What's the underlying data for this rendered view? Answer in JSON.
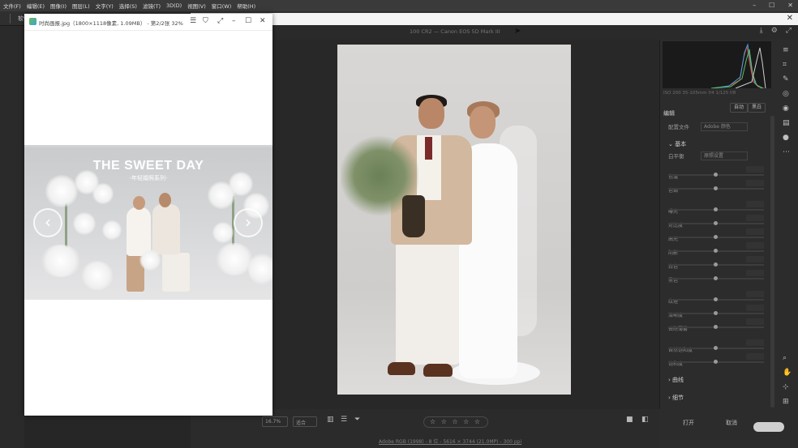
{
  "photoshop": {
    "menu": [
      "文件(F)",
      "编辑(E)",
      "图像(I)",
      "图层(L)",
      "文字(Y)",
      "选择(S)",
      "滤镜(T)",
      "3D(D)",
      "视图(V)",
      "窗口(W)",
      "帮助(H)"
    ],
    "option_label": "软件"
  },
  "viewer": {
    "title": "时尚画报.jpg（1800×1118像素, 1.09MB） - 第2/2张 32%",
    "controls": {
      "menu": "☰",
      "pin": "⛉",
      "fullscreen": "⤢",
      "minimize": "–",
      "maximize": "☐",
      "close": "✕"
    },
    "banner_title": "THE SWEET DAY",
    "banner_subtitle": "-年轻婚照系列-",
    "prev_arrow": "‹",
    "next_arrow": "›"
  },
  "camera_raw": {
    "header_info": "100 CR2 — Canon EOS 5D Mark III",
    "histogram_meta": "ISO 200   35-105mm f/4   1/125   f/8",
    "panel_title": "编辑",
    "auto_label": "自动",
    "bw_label": "黑白",
    "profile_label": "配置文件",
    "profile_value": "Adobe 颜色",
    "basic_label": "基本",
    "white_balance_label": "白平衡",
    "white_balance_value": "原照设置",
    "sliders": [
      "色温",
      "色调",
      "曝光",
      "对比度",
      "高光",
      "阴影",
      "白色",
      "黑色",
      "纹理",
      "清晰度",
      "去除薄雾",
      "自然饱和度",
      "饱和度"
    ],
    "collapsed_sections": [
      "曲线",
      "细节"
    ],
    "zoom_value": "16.7%",
    "zoom_fit": "适合",
    "stars": "☆ ☆ ☆ ☆ ☆",
    "footer_link": "Adobe RGB (1998) - 8 位 - 5616 × 3744 (21.0MP) - 300 ppi",
    "open_label": "打开",
    "cancel_label": "取消",
    "close_label": "✕"
  }
}
